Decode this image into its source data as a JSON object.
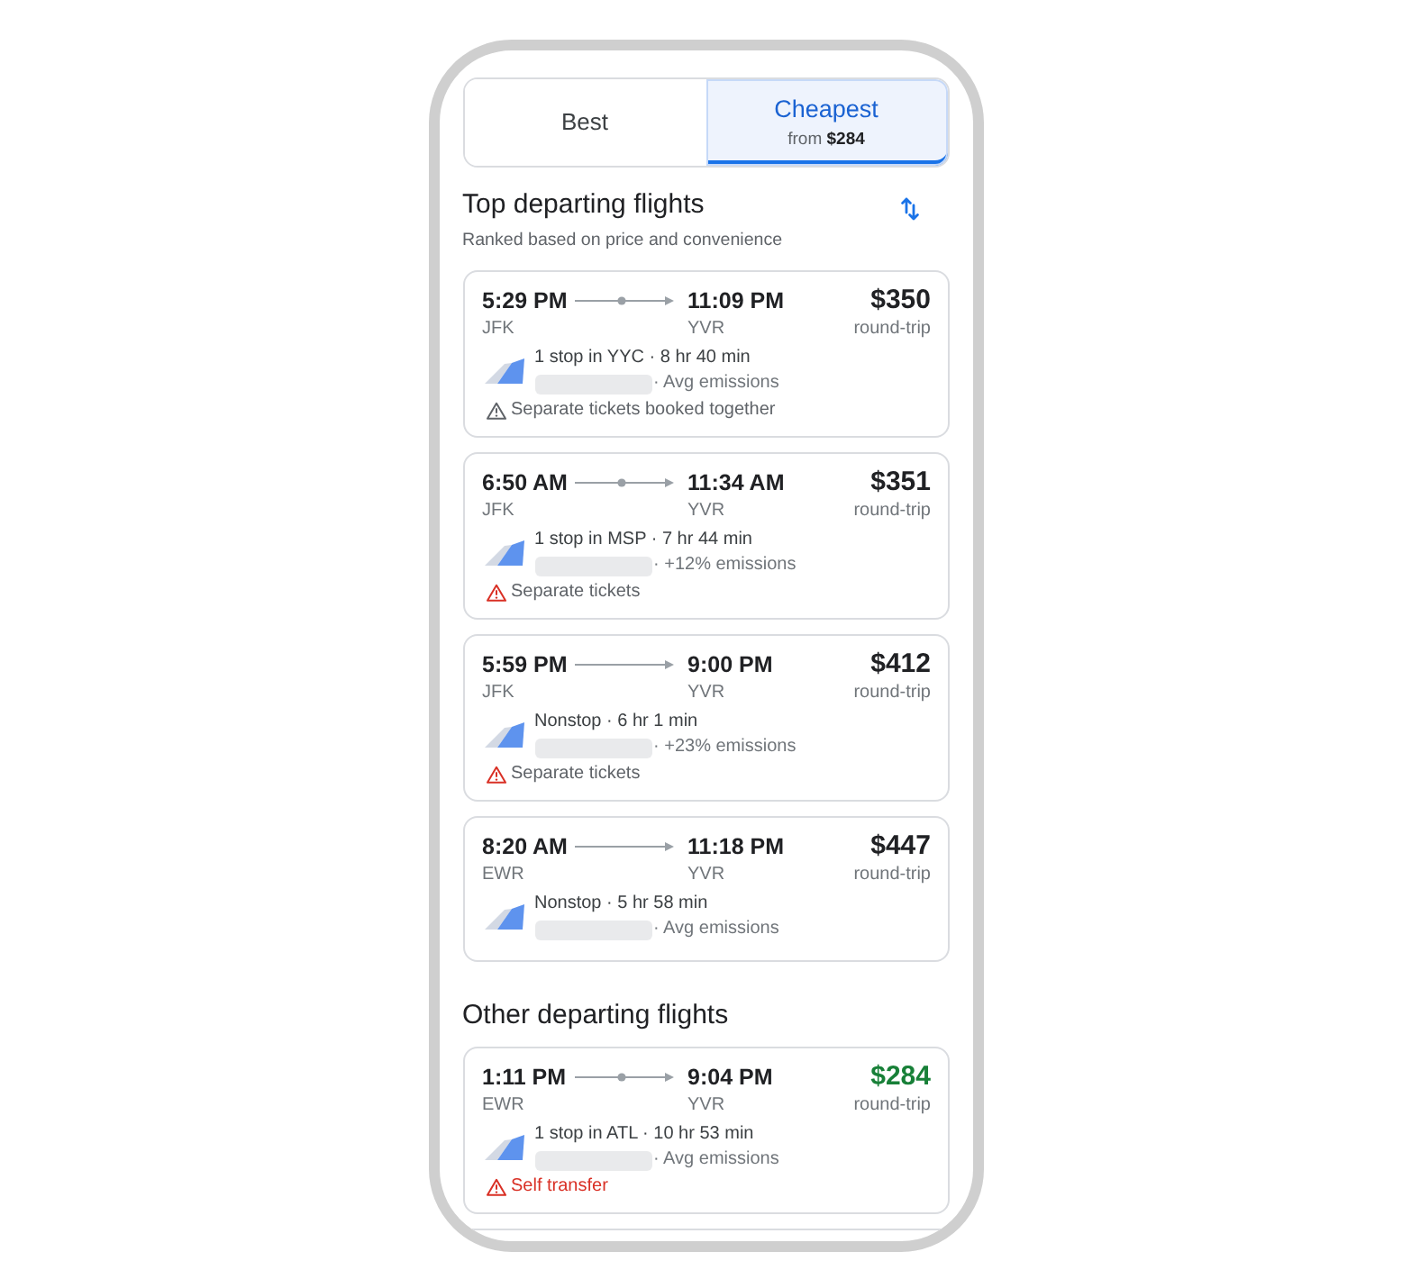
{
  "tabs": [
    {
      "label": "Best",
      "selected": false
    },
    {
      "label": "Cheapest",
      "subtitle": "from **$284**",
      "selected": true
    }
  ],
  "sections": [
    {
      "title": "Top departing flights",
      "subtitle": "Ranked based on price and convenience",
      "sortable": true,
      "flights": [
        {
          "depart": "5:29 PM",
          "arrive": "11:09 PM",
          "from": "JFK",
          "to": "YVR",
          "price": "$350",
          "price_note": "round-trip",
          "lowest_price": false,
          "stopover": true,
          "stops": "1 stop in YYC · 8 hr 40 min",
          "emissions": "· Avg emissions",
          "warning": {
            "kind": "info",
            "text": "Separate tickets booked together"
          }
        },
        {
          "depart": "6:50 AM",
          "arrive": "11:34 AM",
          "from": "JFK",
          "to": "YVR",
          "price": "$351",
          "price_note": "round-trip",
          "lowest_price": false,
          "stopover": true,
          "stops": "1 stop in MSP · 7 hr 44 min",
          "emissions": "· +12% emissions",
          "warning": {
            "kind": "caution",
            "text": "Separate tickets"
          }
        },
        {
          "depart": "5:59 PM",
          "arrive": "9:00 PM",
          "from": "JFK",
          "to": "YVR",
          "price": "$412",
          "price_note": "round-trip",
          "lowest_price": false,
          "stopover": false,
          "stops": "Nonstop · 6 hr 1 min",
          "emissions": "· +23% emissions",
          "warning": {
            "kind": "caution",
            "text": "Separate tickets"
          }
        },
        {
          "depart": "8:20 AM",
          "arrive": "11:18 PM",
          "from": "EWR",
          "to": "YVR",
          "price": "$447",
          "price_note": "round-trip",
          "lowest_price": false,
          "stopover": false,
          "stops": "Nonstop · 5 hr 58 min",
          "emissions": "· Avg emissions"
        }
      ]
    },
    {
      "title": "Other departing flights",
      "sortable": false,
      "flights": [
        {
          "depart": "1:11 PM",
          "arrive": "9:04 PM",
          "from": "EWR",
          "to": "YVR",
          "price": "$284",
          "price_note": "round-trip",
          "lowest_price": true,
          "stopover": true,
          "stops": "1 stop in ATL · 10 hr 53 min",
          "emissions": "· Avg emissions",
          "warning": {
            "kind": "alert",
            "text": "Self transfer"
          }
        }
      ]
    }
  ]
}
